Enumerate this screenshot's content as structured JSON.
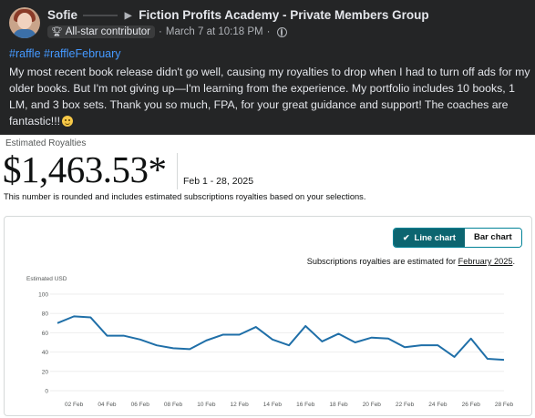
{
  "post": {
    "author": "Sofie",
    "group": "Fiction Profits Academy - Private Members Group",
    "badge": "All-star contributor",
    "timestamp": "March 7 at 10:18 PM",
    "hashtags": "#raffle #raffleFebruary",
    "body": "My most recent book release didn't go well, causing my royalties to drop when I had to turn off ads for my older books. But I'm not giving up—I'm learning from the experience. My portfolio includes 10 books, 1 LM, and 3 box sets. Thank you so much, FPA, for your great guidance and support! The coaches are fantastic!!!"
  },
  "royalties": {
    "label": "Estimated Royalties",
    "amount": "$1,463.53*",
    "date_range": "Feb 1 - 28, 2025",
    "note": "This number is rounded and includes estimated subscriptions royalties based on your selections.",
    "toggle": {
      "line_label": "Line chart",
      "bar_label": "Bar chart",
      "selected": "Line chart"
    },
    "subscriptions_note_prefix": "Subscriptions royalties are estimated for",
    "subscriptions_month": "February 2025",
    "subscriptions_note_suffix": "."
  },
  "colors": {
    "accent": "#0c6570",
    "line": "#1f6fa8",
    "link": "#4599ff"
  },
  "chart_data": {
    "type": "line",
    "ylabel": "Estimated USD",
    "ylim": [
      0,
      100
    ],
    "yticks": [
      0,
      20,
      40,
      60,
      80,
      100
    ],
    "x": [
      1,
      2,
      3,
      4,
      5,
      6,
      7,
      8,
      9,
      10,
      11,
      12,
      13,
      14,
      15,
      16,
      17,
      18,
      19,
      20,
      21,
      22,
      23,
      24,
      25,
      26,
      27,
      28
    ],
    "xticks": [
      "02 Feb",
      "04 Feb",
      "06 Feb",
      "08 Feb",
      "10 Feb",
      "12 Feb",
      "14 Feb",
      "16 Feb",
      "18 Feb",
      "20 Feb",
      "22 Feb",
      "24 Feb",
      "26 Feb",
      "28 Feb"
    ],
    "xtick_days": [
      2,
      4,
      6,
      8,
      10,
      12,
      14,
      16,
      18,
      20,
      22,
      24,
      26,
      28
    ],
    "series": [
      {
        "values": [
          70,
          77,
          76,
          57,
          57,
          53,
          47,
          44,
          43,
          52,
          58,
          58,
          66,
          53,
          47,
          67,
          51,
          59,
          50,
          55,
          54,
          45,
          47,
          47,
          35,
          54,
          33,
          32
        ]
      }
    ],
    "grid": "horizontal",
    "legend": "none"
  }
}
